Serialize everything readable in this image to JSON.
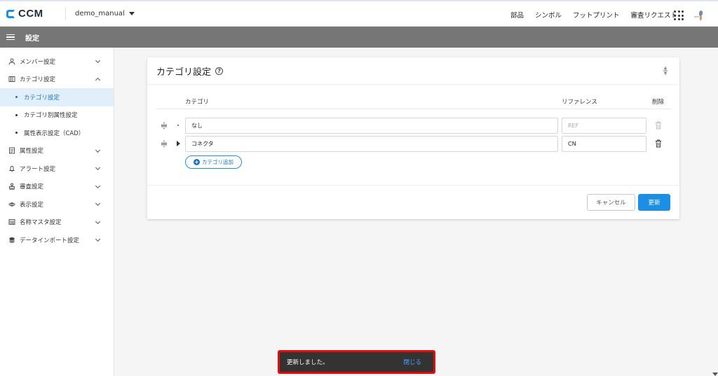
{
  "app": {
    "logo_text": "CCM",
    "project": "demo_manual",
    "nav": [
      "部品",
      "シンボル",
      "フットプリント",
      "審査リクエスト"
    ],
    "brand_color": "#1a8fe3"
  },
  "titlebar": {
    "title": "設定"
  },
  "sidebar": {
    "items": [
      {
        "label": "メンバー設定",
        "icon": "person-icon"
      },
      {
        "label": "カテゴリ設定",
        "icon": "category-list-icon"
      },
      {
        "label": "属性設定",
        "icon": "document-icon"
      },
      {
        "label": "アラート設定",
        "icon": "bell-icon"
      },
      {
        "label": "審査設定",
        "icon": "stamp-icon"
      },
      {
        "label": "表示設定",
        "icon": "eye-icon"
      },
      {
        "label": "名称マスタ設定",
        "icon": "table-icon"
      },
      {
        "label": "データインポート設定",
        "icon": "database-icon"
      }
    ],
    "sub_items": [
      "カテゴリ設定",
      "カテゴリ別属性設定",
      "属性表示設定（CAD）"
    ]
  },
  "card": {
    "title": "カテゴリ設定",
    "help": "?",
    "headers": {
      "category": "カテゴリ",
      "reference": "リファレンス",
      "delete": "削除"
    },
    "rows": [
      {
        "category": "なし",
        "reference": "",
        "reference_placeholder": "REF"
      },
      {
        "category": "コネクタ",
        "reference": "CN",
        "reference_placeholder": ""
      }
    ],
    "add_button": "カテゴリ追加",
    "cancel_button": "キャンセル",
    "update_button": "更新"
  },
  "toast": {
    "message": "更新しました。",
    "close": "閉じる"
  }
}
